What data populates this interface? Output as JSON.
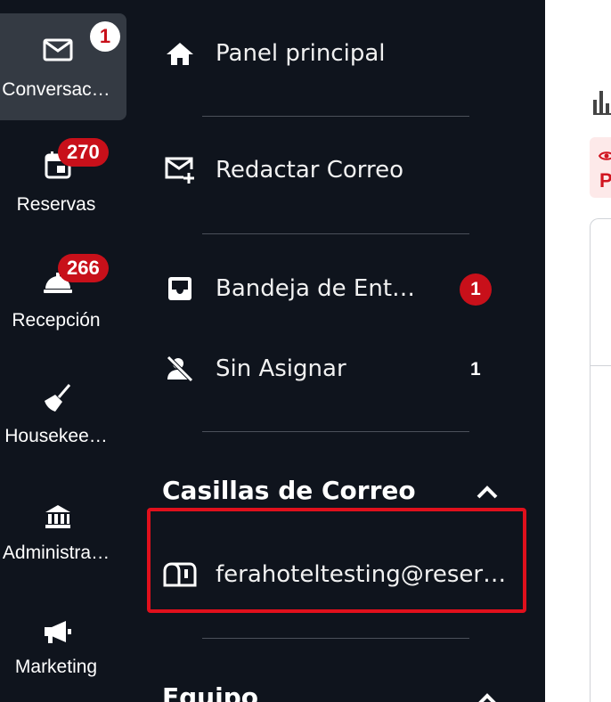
{
  "rail": {
    "items": [
      {
        "label": "Conversac…",
        "icon": "mail-icon",
        "badge": "1",
        "active": true
      },
      {
        "label": "Reservas",
        "icon": "calendar-icon",
        "badge": "270"
      },
      {
        "label": "Recepción",
        "icon": "bell-icon",
        "badge": "266"
      },
      {
        "label": "Housekee…",
        "icon": "broom-icon"
      },
      {
        "label": "Administra…",
        "icon": "bank-icon"
      },
      {
        "label": "Marketing",
        "icon": "megaphone-icon"
      }
    ]
  },
  "menu": {
    "items": [
      {
        "label": "Panel principal",
        "icon": "home-icon"
      },
      {
        "label": "Redactar Correo",
        "icon": "compose-mail-icon"
      },
      {
        "label": "Bandeja de Ent…",
        "icon": "inbox-icon",
        "count": "1"
      },
      {
        "label": "Sin Asignar",
        "icon": "unassigned-user-icon",
        "count": "1"
      }
    ],
    "mailboxes": {
      "title": "Casillas de Correo",
      "items": [
        {
          "label": "ferahoteltesting@reserv…",
          "icon": "mailbox-icon"
        }
      ]
    },
    "team": {
      "title": "Equipo"
    }
  },
  "colors": {
    "background": "#0f141d",
    "active_rail": "#343a43",
    "badge": "#c8101a",
    "highlight": "#e0101c"
  },
  "right_peek": {
    "tag_text": "P"
  }
}
